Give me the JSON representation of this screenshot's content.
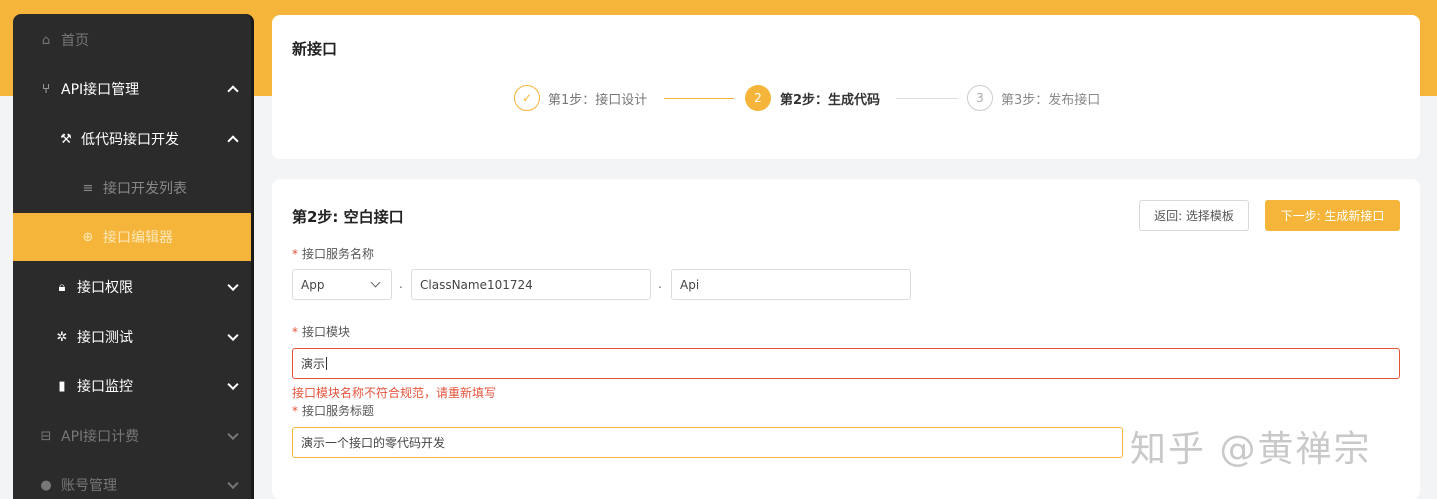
{
  "sidebar": {
    "home": "首页",
    "api_mgmt": "API接口管理",
    "lowcode": "低代码接口开发",
    "dev_list": "接口开发列表",
    "editor": "接口编辑器",
    "perm": "接口权限",
    "test": "接口测试",
    "monitor": "接口监控",
    "billing": "API接口计费",
    "account": "账号管理"
  },
  "header_card": {
    "title": "新接口",
    "steps": [
      {
        "index": "✓",
        "label": "第1步：接口设计",
        "status": "done"
      },
      {
        "index": "2",
        "label": "第2步：生成代码",
        "status": "active"
      },
      {
        "index": "3",
        "label": "第3步：发布接口",
        "status": "wait"
      }
    ]
  },
  "form_card": {
    "title": "第2步: 空白接口",
    "back_button": "返回: 选择模板",
    "next_button": "下一步: 生成新接口",
    "service_name_label": "接口服务名称",
    "app_select": "App",
    "class_name": "ClassName101724",
    "api_value": "Api",
    "dot": ".",
    "module_label": "接口模块",
    "module_value": "演示",
    "module_error": "接口模块名称不符合规范，请重新填写",
    "service_title_label": "接口服务标题",
    "service_title_value": "演示一个接口的零代码开发",
    "required_mark": "*"
  },
  "watermark": "知乎 @黄禅宗",
  "colors": {
    "accent": "#f5b53b",
    "sidebar_bg": "#2b2b2b",
    "error": "#e5533c"
  }
}
